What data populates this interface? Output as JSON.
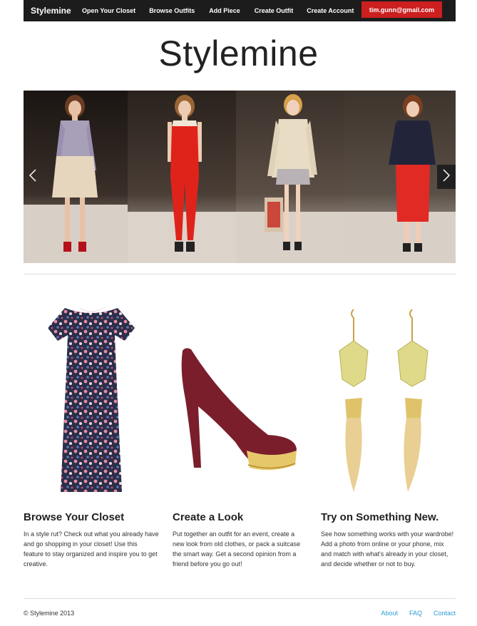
{
  "nav": {
    "brand": "Stylemine",
    "items": [
      "Open Your Closet",
      "Browse Outfits",
      "Add Piece",
      "Create Outfit",
      "Create Account"
    ],
    "user": "tim.gunn@gmail.com"
  },
  "hero": {
    "title": "Stylemine"
  },
  "features": [
    {
      "title": "Browse Your Closet",
      "text": "In a style rut? Check out what you already have and go shopping in your closet! Use this feature to stay organized and inspire you to get creative."
    },
    {
      "title": "Create a Look",
      "text": "Put together an outfit for an event, create a new look from old clothes, or pack a suitcase the smart way. Get a second opinion from a friend before you go out!"
    },
    {
      "title": "Try on Something New.",
      "text": "See how something works with your wardrobe! Add a photo from online or your phone, mix and match with what's already in your closet, and decide whether or not to buy."
    }
  ],
  "footer": {
    "copyright": "© Stylemine 2013",
    "links": [
      "About",
      "FAQ",
      "Contact"
    ]
  },
  "colors": {
    "accent": "#cc1f1f",
    "link": "#2a9fd6",
    "navbar": "#1c1c1c"
  }
}
